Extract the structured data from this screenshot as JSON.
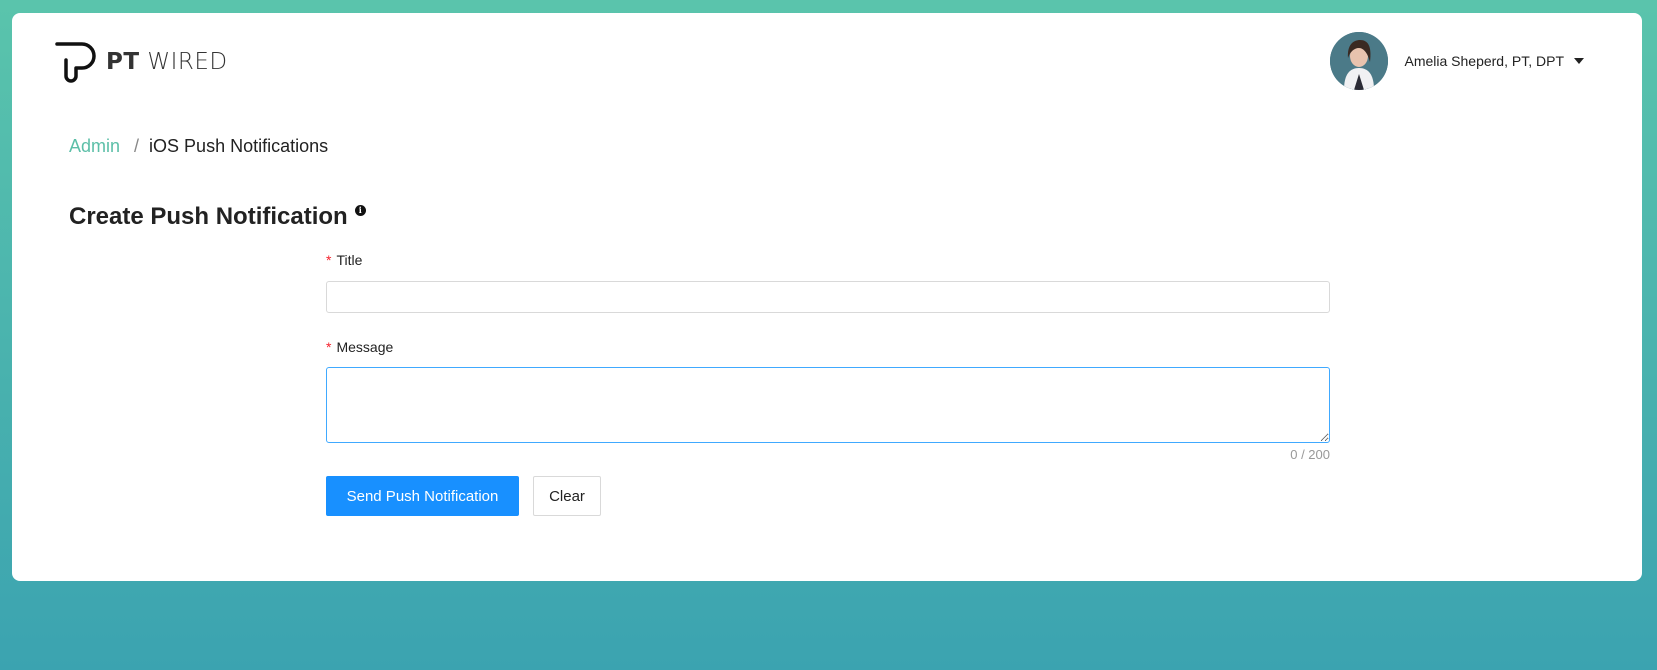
{
  "brand": {
    "bold": "PT",
    "light": "WIRED"
  },
  "user": {
    "name": "Amelia Sheperd, PT, DPT"
  },
  "breadcrumb": {
    "root": "Admin",
    "separator": "/",
    "current": "iOS Push Notifications"
  },
  "page": {
    "title": "Create Push Notification",
    "info_icon": "info-icon"
  },
  "form": {
    "required_mark": "*",
    "title_label": "Title",
    "title_value": "",
    "message_label": "Message",
    "message_value": "",
    "counter": "0 / 200"
  },
  "actions": {
    "send_label": "Send Push Notification",
    "clear_label": "Clear"
  },
  "colors": {
    "accent": "#5cbfa8",
    "primary_button": "#1890ff",
    "required": "#f5222d",
    "focus_border": "#40a9ff"
  }
}
